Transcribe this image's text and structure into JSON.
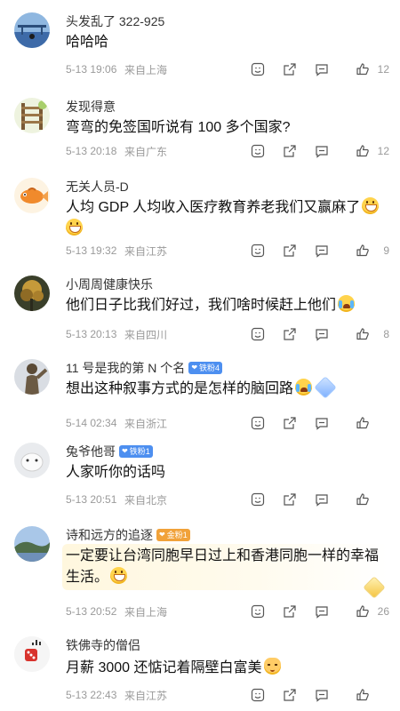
{
  "comments": [
    {
      "username": "头发乱了 322-925",
      "text": "哈哈哈",
      "time": "5-13 19:06",
      "location": "来自上海",
      "likes": "12"
    },
    {
      "username": "发现得意",
      "text": "弯弯的免签国听说有 100 多个国家?",
      "time": "5-13 20:18",
      "location": "来自广东",
      "likes": "12"
    },
    {
      "username": "无关人员-D",
      "text_line1": "人均 GDP 人均收入医疗教育养老我们又赢麻了",
      "time": "5-13 19:32",
      "location": "来自江苏",
      "likes": "9"
    },
    {
      "username": "小周周健康快乐",
      "text": "他们日子比我们好过，我们啥时候赶上他们",
      "time": "5-13 20:13",
      "location": "来自四川",
      "likes": "8"
    },
    {
      "username": "11 号是我的第 N 个名",
      "badge": "铁粉4",
      "text": "想出这种叙事方式的是怎样的脑回路",
      "time": "5-14 02:34",
      "location": "来自浙江",
      "likes": ""
    },
    {
      "username": "兔爷他哥",
      "badge": "铁粉1",
      "text": "人家听你的话吗",
      "time": "5-13 20:51",
      "location": "来自北京",
      "likes": ""
    },
    {
      "username": "诗和远方的追逐",
      "badge": "金粉1",
      "text_line1": "一定要让台湾同胞早日过上和香港同胞一样的幸福",
      "text_line2": "生活。",
      "time": "5-13 20:52",
      "location": "来自上海",
      "likes": "26"
    },
    {
      "username": "铁佛寺的僧侣",
      "text": "月薪 3000 还惦记着隔壁白富美",
      "time": "5-13 22:43",
      "location": "来自江苏",
      "likes": ""
    }
  ],
  "colors": {
    "badge_blue": "#4d8ff0",
    "badge_gold": "#f1a23a",
    "meta_gray": "#9a9a9a"
  },
  "icons": [
    "smile-icon",
    "share-icon",
    "comment-icon",
    "like-icon"
  ]
}
